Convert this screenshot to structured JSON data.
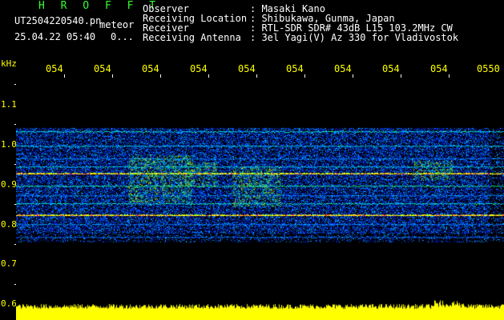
{
  "app": {
    "title": "H R O F F T",
    "filename": "UT2504220540.pn",
    "mode": "meteor",
    "datetime": "25.04.22 05:40",
    "counter": "0..."
  },
  "info": {
    "rows": [
      {
        "key": "Observer",
        "value": ": Masaki Kano"
      },
      {
        "key": "Receiving Location",
        "value": ": Shibukawa, Gunma, Japan"
      },
      {
        "key": "Receiver",
        "value": ": RTL-SDR SDR# 43dB L15 103.2MHz CW"
      },
      {
        "key": "Receiving Antenna",
        "value": ": 3el Yagi(V) Az 330 for Vladivostok"
      }
    ]
  },
  "axes": {
    "y_unit": "kHz",
    "x_ticks": [
      "054",
      "054",
      "054",
      "054",
      "054",
      "054",
      "054",
      "054",
      "054",
      "0550"
    ],
    "y_ticks": [
      "1.1",
      "1.0",
      "0.9",
      "0.8",
      "0.7",
      "0.6"
    ]
  },
  "colors": {
    "title": "#33ff33",
    "tick_text": "#ffff00",
    "background": "#000000",
    "noise_low": "#0000c0",
    "noise_mid": "#00c0ff",
    "noise_high": "#ffff00",
    "line_strong": "#ff3060",
    "amplitude_bar": "#ffff00"
  }
}
